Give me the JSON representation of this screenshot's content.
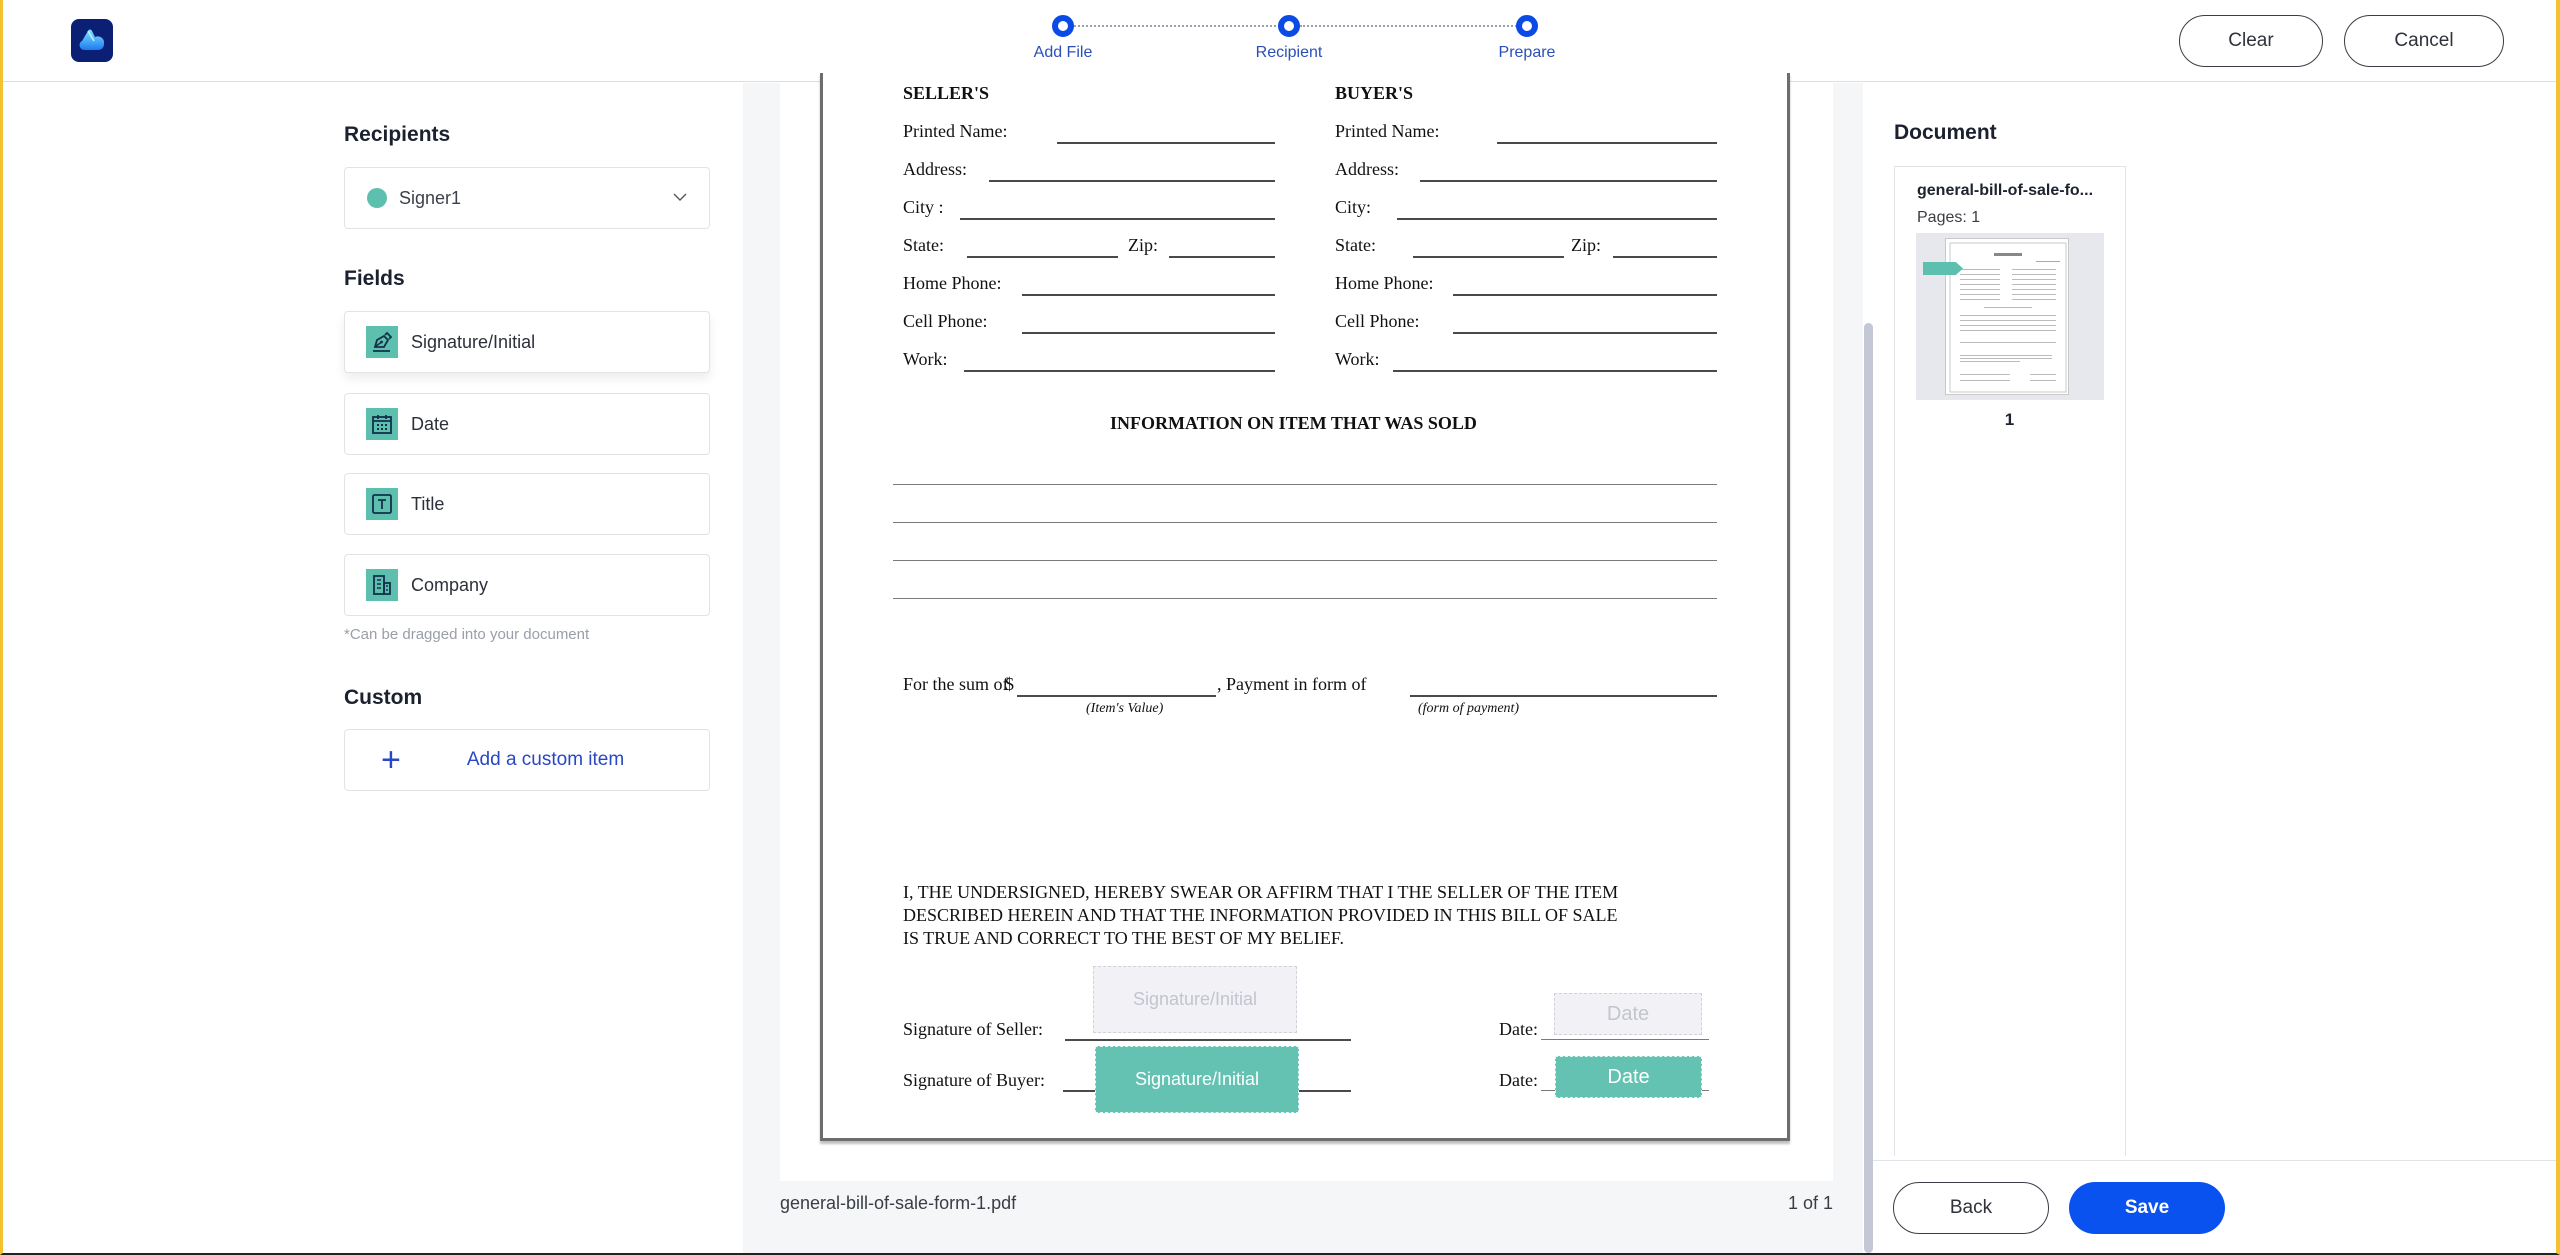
{
  "header": {
    "logo_icon": "cloud-logo-icon",
    "steps": [
      {
        "label": "Add File"
      },
      {
        "label": "Recipient"
      },
      {
        "label": "Prepare"
      }
    ],
    "clear_label": "Clear",
    "cancel_label": "Cancel"
  },
  "left_panel": {
    "recipients_title": "Recipients",
    "selected_recipient": "Signer1",
    "recipient_color": "#5dbfae",
    "fields_title": "Fields",
    "fields": [
      {
        "label": "Signature/Initial",
        "icon": "signature-pen-icon"
      },
      {
        "label": "Date",
        "icon": "calendar-icon"
      },
      {
        "label": "Title",
        "icon": "text-title-icon"
      },
      {
        "label": "Company",
        "icon": "building-icon"
      }
    ],
    "drag_hint": "*Can be dragged into your document",
    "custom_title": "Custom",
    "add_custom_label": "Add a custom item"
  },
  "document": {
    "seller_heading": "SELLER'S",
    "buyer_heading": "BUYER'S",
    "labels": {
      "printed_name": "Printed Name:",
      "address": "Address:",
      "city_seller": "City :",
      "city_buyer": "City:",
      "state": "State:",
      "zip": "Zip:",
      "home_phone": "Home Phone:",
      "cell_phone": "Cell Phone:",
      "work": "Work:"
    },
    "info_heading": "INFORMATION ON ITEM THAT WAS SOLD",
    "sum_label": "For the sum of",
    "dollar": "$",
    "payment_label": ", Payment in form of",
    "item_value_caption": "(Item's Value)",
    "form_of_payment_caption": "(form of payment)",
    "declaration": [
      "I, THE UNDERSIGNED, HEREBY SWEAR OR AFFIRM THAT I THE SELLER OF THE ITEM",
      "DESCRIBED HEREIN AND THAT THE INFORMATION PROVIDED IN THIS BILL OF SALE",
      "IS TRUE AND CORRECT TO THE BEST OF MY BELIEF."
    ],
    "sig_seller_label": "Signature of Seller:",
    "sig_buyer_label": "Signature of Buyer:",
    "date_label": "Date:",
    "placed_fields": {
      "seller_signature": "Signature/Initial",
      "seller_date": "Date",
      "buyer_signature": "Signature/Initial",
      "buyer_date": "Date"
    },
    "accent_color": "#63c2b2"
  },
  "viewer_footer": {
    "file_name": "general-bill-of-sale-form-1.pdf",
    "page_indicator": "1 of 1"
  },
  "right_panel": {
    "title": "Document",
    "doc_name": "general-bill-of-sale-fo...",
    "pages": "Pages: 1",
    "thumb_page_number": "1",
    "back_label": "Back",
    "save_label": "Save",
    "save_color": "#0a52f0"
  }
}
